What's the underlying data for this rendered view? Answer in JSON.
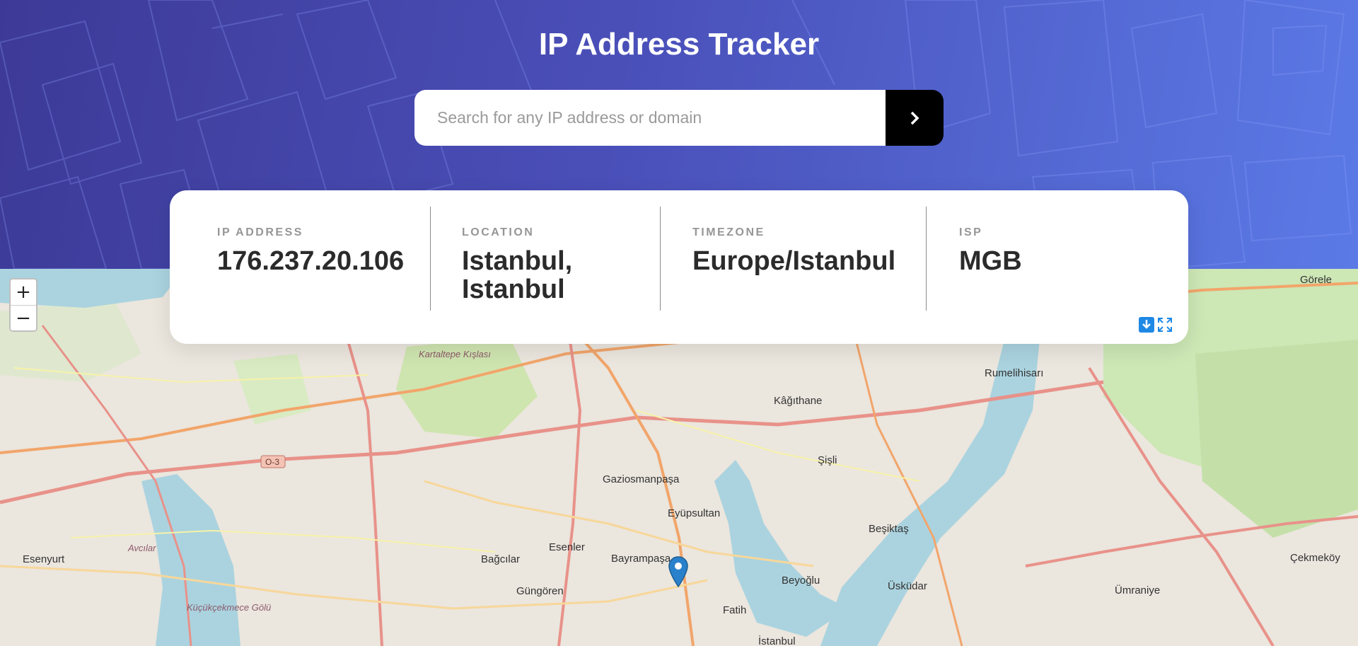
{
  "header": {
    "title": "IP Address Tracker",
    "search": {
      "placeholder": "Search for any IP address or domain",
      "value": ""
    },
    "submit_icon": "chevron-right-icon"
  },
  "info": {
    "ip": {
      "label": "IP ADDRESS",
      "value": "176.237.20.106"
    },
    "location": {
      "label": "LOCATION",
      "value": "Istanbul, Istanbul"
    },
    "timezone": {
      "label": "TIMEZONE",
      "value": "Europe/Istanbul"
    },
    "isp": {
      "label": "ISP",
      "value": "MGB"
    },
    "icons": [
      "download-icon",
      "expand-icon"
    ]
  },
  "map": {
    "zoom_in": "+",
    "zoom_out": "−",
    "place_labels": [
      "Görele",
      "Rumelihisarı",
      "Kâğıthane",
      "Şişli",
      "Beşiktaş",
      "Gaziosmanpaşa",
      "Eyüpsultan",
      "Esenler",
      "Bayrampaşa",
      "Bağcılar",
      "Güngören",
      "Beyoğlu",
      "Üsküdar",
      "Ümraniye",
      "Çekmeköy",
      "Fatih",
      "İstanbul",
      "Esenyurt",
      "Avcılar",
      "Küçükçekmece Gölü",
      "Kartaltepe Kışlası",
      "O-3"
    ],
    "marker_icon": "location-pin-icon"
  },
  "colors": {
    "header_gradient_start": "#3d3a97",
    "header_gradient_end": "#5b7ae6",
    "button": "#000000",
    "label": "#969696",
    "value": "#2b2b2b",
    "water": "#aad3df",
    "green": "#cde7b5",
    "marker": "#2a81cb"
  }
}
